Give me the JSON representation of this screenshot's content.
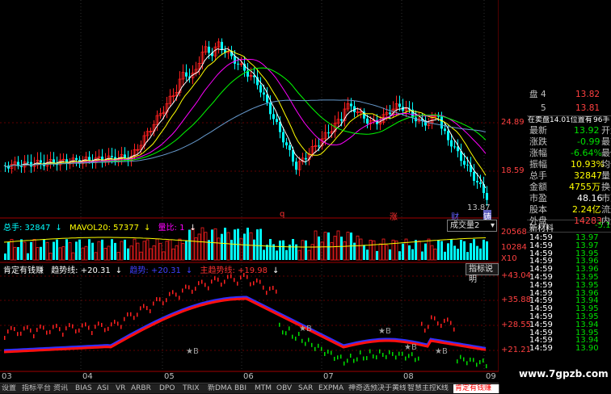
{
  "main_panel": {
    "price_axis": [
      "24.89",
      "18.59"
    ],
    "last_price_label": "13.87",
    "markers": [
      {
        "text": "q",
        "color": "#ff3030"
      },
      {
        "text": "涨",
        "color": "#ff3030"
      },
      {
        "text": "财",
        "color": "#6060ff"
      },
      {
        "text": "铸",
        "color": "#ffffff"
      }
    ]
  },
  "volume_panel": {
    "total_label": "总手: 32847",
    "ma_label": "MAVOL20: 57377",
    "ratio_label": "量比: 1",
    "selector_value": "成交量2",
    "axis": [
      "20568",
      "10284"
    ],
    "unit": "X10"
  },
  "indicator_panel": {
    "name": "肯定有钱赚",
    "trend_label": "趋势线: +20.31",
    "red_label": "趋势: +20.31",
    "main_label": "主趋势线: +19.98",
    "explain_button": "指标说明",
    "axis": [
      "+43.04",
      "+35.88",
      "+28.55",
      "+21.21"
    ],
    "star_labels": [
      "B",
      "B",
      "B",
      "B",
      "B"
    ]
  },
  "date_axis": [
    "03",
    "04",
    "05",
    "06",
    "07",
    "08",
    "09"
  ],
  "tabs": [
    "设置",
    "指标平台",
    "资讯",
    "BIAS",
    "ASI",
    "VR",
    "ARBR",
    "DPO",
    "TRIX",
    "新DMA",
    "BBI",
    "MTM",
    "OBV",
    "SAR",
    "EXPMA",
    "神奇选预决于黄线",
    "智慧主控K线",
    "肯定有钱赚"
  ],
  "active_tab": "肯定有钱赚",
  "quote_panel": {
    "header_label": "盘",
    "bid_rows": [
      {
        "level": "4",
        "price": "13.82"
      },
      {
        "level": "5",
        "price": "13.81"
      }
    ],
    "position_label": "在卖盘14.01位置有",
    "position_value": "96手",
    "rows": [
      {
        "label": "最新",
        "value": "13.92",
        "extra": "开盘",
        "color": "#00e000"
      },
      {
        "label": "涨跌",
        "value": "-0.99",
        "extra": "最高",
        "color": "#00e000"
      },
      {
        "label": "涨幅",
        "value": "-6.64%",
        "extra": "最低",
        "color": "#00e000"
      },
      {
        "label": "振幅",
        "value": "10.93%",
        "extra": "均价",
        "color": "#ffff00"
      },
      {
        "label": "总手",
        "value": "32847",
        "extra": "量比",
        "color": "#ffff00"
      },
      {
        "label": "金额",
        "value": "4755万",
        "extra": "换手",
        "color": "#ffff00"
      },
      {
        "label": "市盈",
        "value": "48.16",
        "extra": "市净",
        "color": "#ffffff"
      },
      {
        "label": "股本",
        "value": "2.24亿",
        "extra": "流通",
        "color": "#ffff00"
      },
      {
        "label": "外盘",
        "value": "14283",
        "extra": "内盘",
        "color": "#ff4040"
      }
    ],
    "news_label": "新材料",
    "news_value": "-5.16",
    "ticks": [
      {
        "time": "14:59",
        "price": "13.97"
      },
      {
        "time": "14:59",
        "price": "13.97"
      },
      {
        "time": "14:59",
        "price": "13.95"
      },
      {
        "time": "14:59",
        "price": "13.96"
      },
      {
        "time": "14:59",
        "price": "13.96"
      },
      {
        "time": "14:59",
        "price": "13.95"
      },
      {
        "time": "14:59",
        "price": "13.95"
      },
      {
        "time": "14:59",
        "price": "13.96"
      },
      {
        "time": "14:59",
        "price": "13.94"
      },
      {
        "time": "14:59",
        "price": "13.95"
      },
      {
        "time": "14:59",
        "price": "13.95"
      },
      {
        "time": "14:59",
        "price": "13.94"
      },
      {
        "time": "14:59",
        "price": "13.95"
      },
      {
        "time": "14:59",
        "price": "13.94"
      },
      {
        "time": "14:59",
        "price": "13.90"
      }
    ]
  },
  "watermark": "www.7gpzb.com",
  "colors": {
    "up": "#ff2020",
    "down": "#00ffff",
    "ma5": "#ffffff",
    "ma10": "#ffff00",
    "ma20": "#ff00ff",
    "ma30": "#00ff00",
    "ma60": "#6699cc",
    "trend_red": "#ff1010",
    "trend_blue": "#3030ff"
  }
}
